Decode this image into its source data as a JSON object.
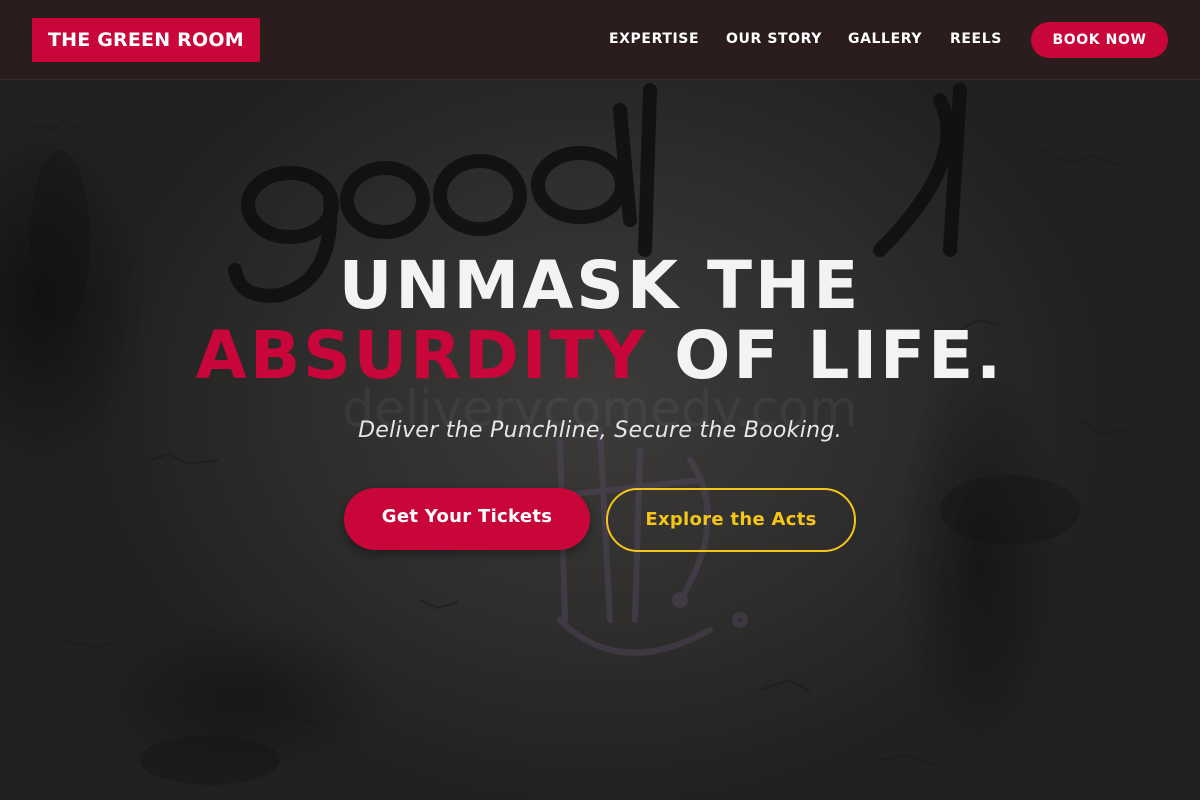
{
  "brand": {
    "logo_text": "THE GREEN ROOM"
  },
  "nav": {
    "items": [
      {
        "label": "EXPERTISE"
      },
      {
        "label": "OUR STORY"
      },
      {
        "label": "GALLERY"
      },
      {
        "label": "REELS"
      }
    ],
    "cta_label": "BOOK NOW"
  },
  "hero": {
    "headline_line1": "UNMASK THE",
    "headline_accent": "ABSURDITY",
    "headline_rest": "OF LIFE.",
    "subtitle": "Deliver the Punchline, Secure the Booking.",
    "primary_cta": "Get Your Tickets",
    "secondary_cta": "Explore the Acts",
    "background_image": "concrete-wall-graffiti",
    "watermark_text": "deliverycomedy.com"
  },
  "colors": {
    "accent": "#c8063a",
    "secondary": "#f5c518",
    "nav_bg": "#2b1d1e"
  }
}
